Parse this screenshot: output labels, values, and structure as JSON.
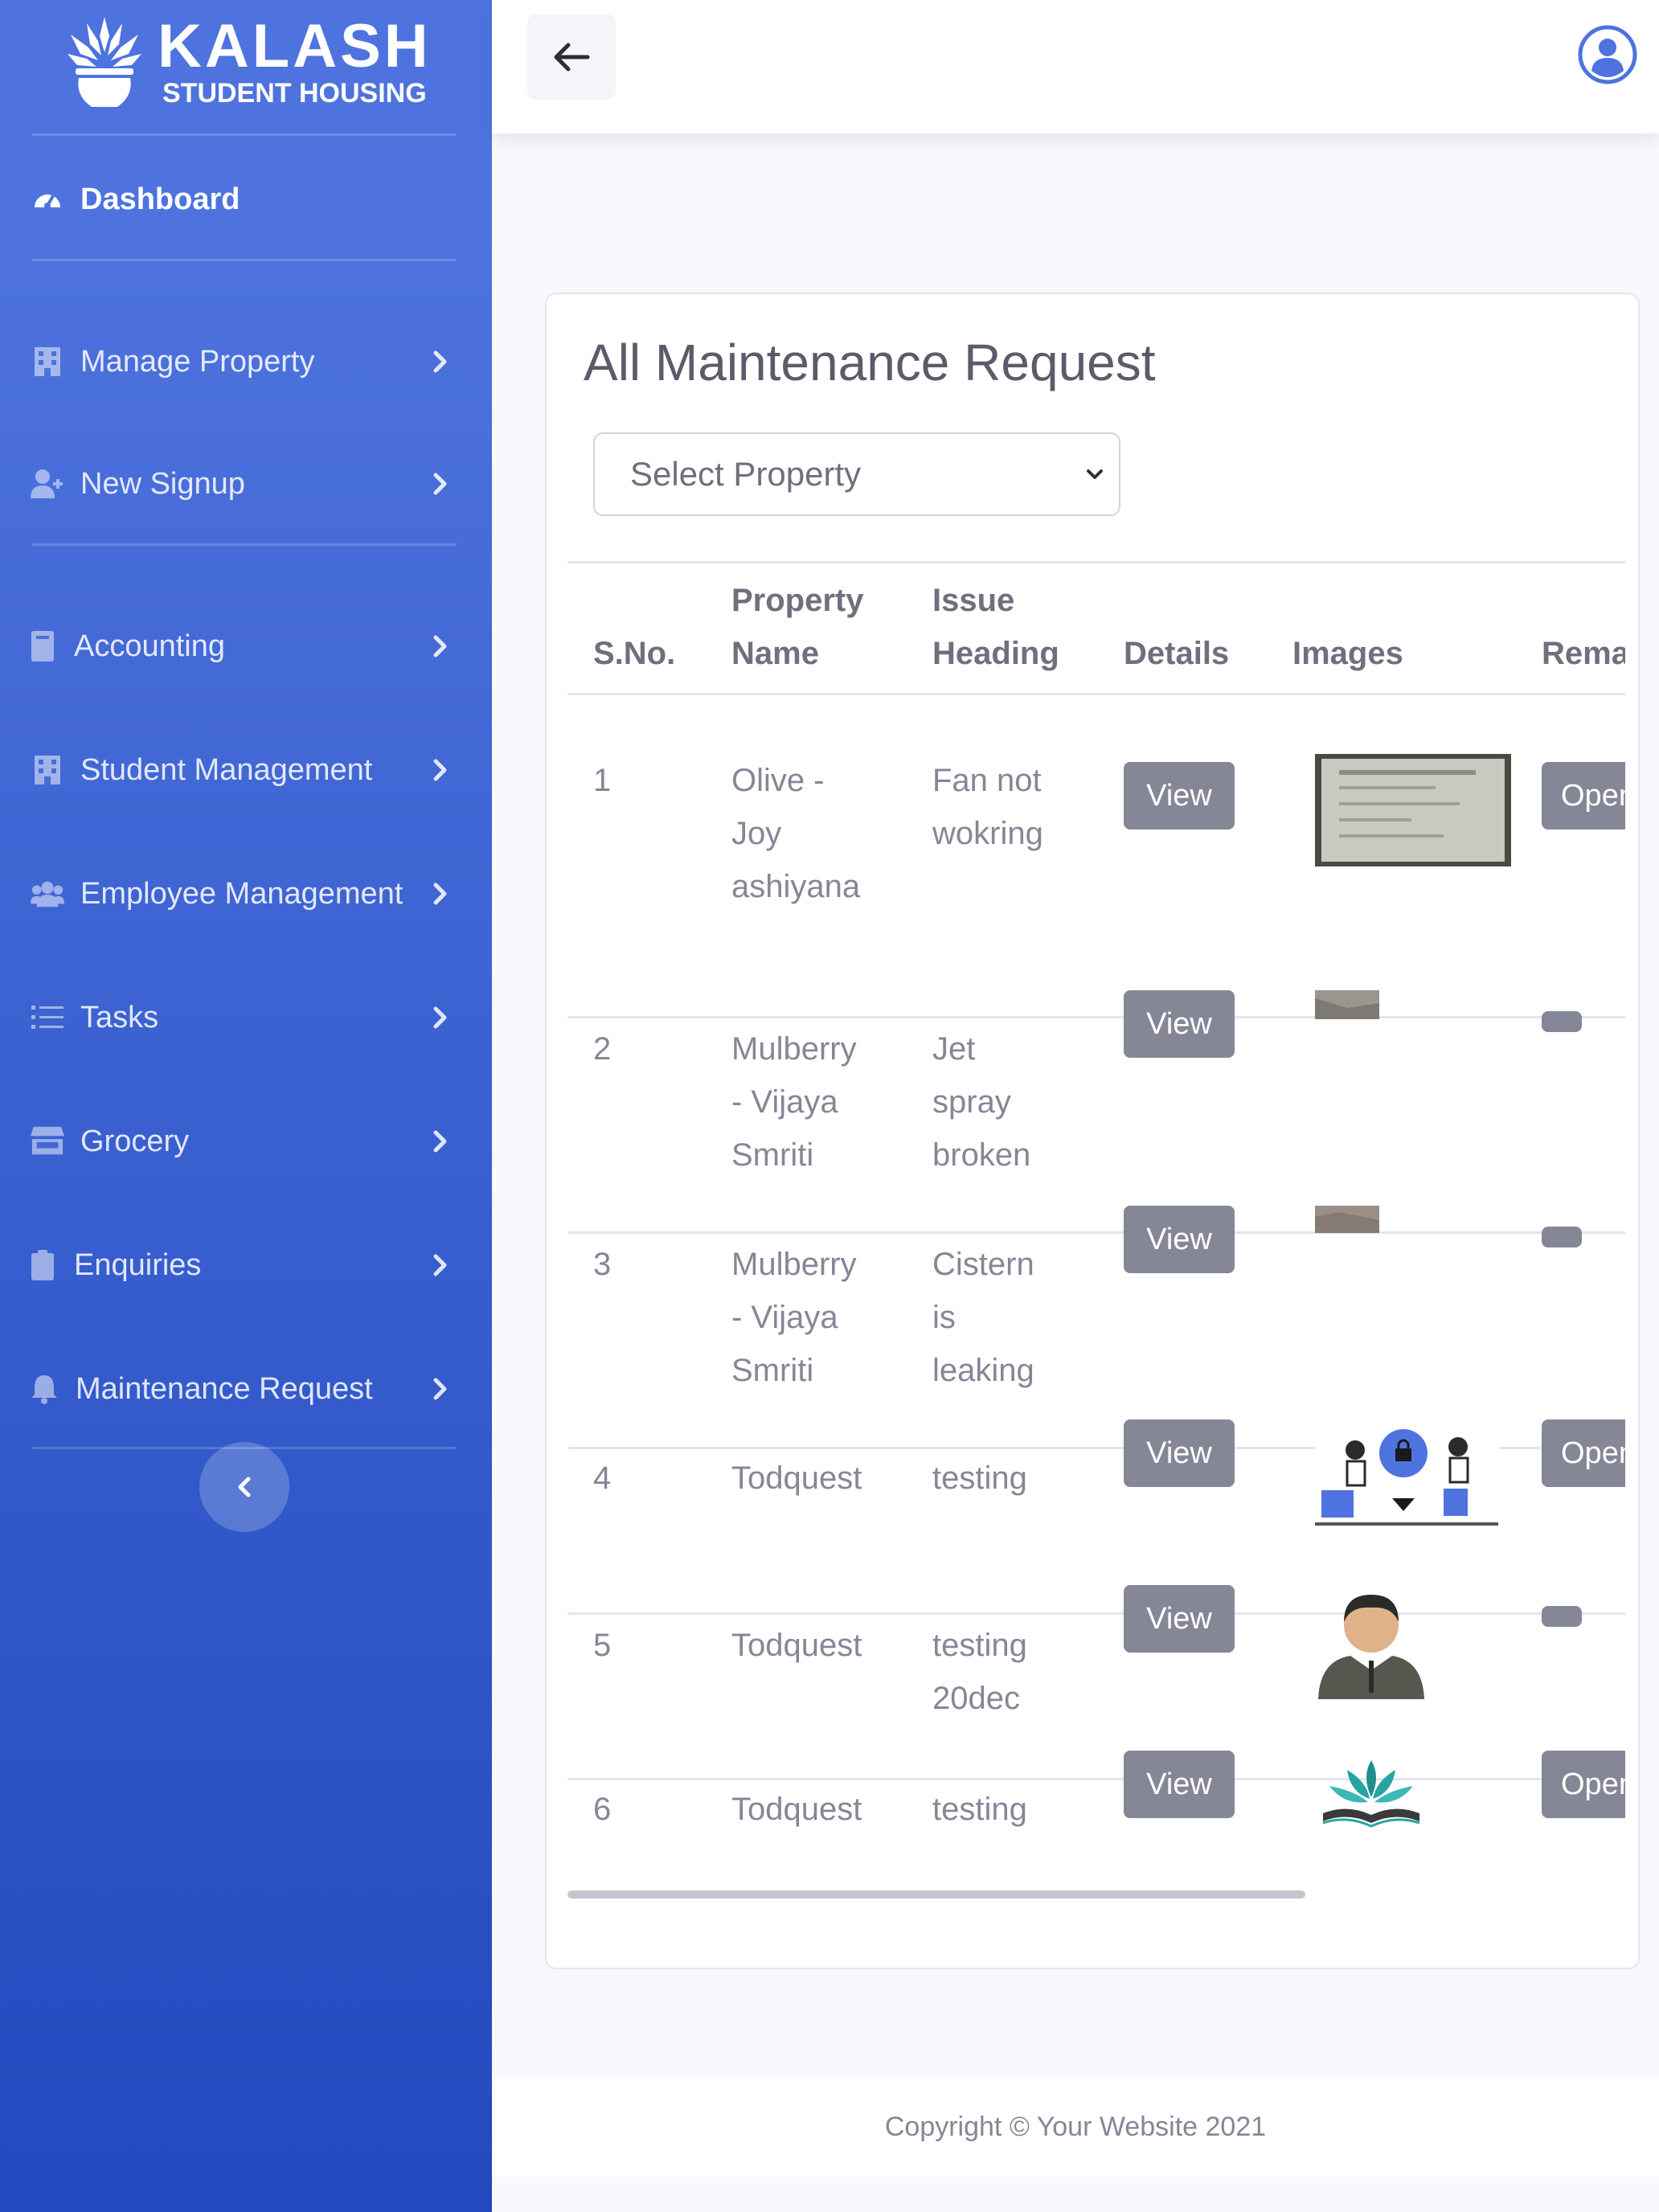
{
  "brand": {
    "title": "KALASH",
    "subtitle": "STUDENT HOUSING"
  },
  "sidebar": {
    "items": [
      {
        "label": "Dashboard",
        "icon": "tachometer-icon",
        "active": true
      },
      {
        "label": "Manage Property",
        "icon": "building-icon"
      },
      {
        "label": "New Signup",
        "icon": "user-plus-icon"
      },
      {
        "label": "Accounting",
        "icon": "book-icon"
      },
      {
        "label": "Student Management",
        "icon": "building-icon"
      },
      {
        "label": "Employee Management",
        "icon": "users-icon"
      },
      {
        "label": "Tasks",
        "icon": "list-icon"
      },
      {
        "label": "Grocery",
        "icon": "store-icon"
      },
      {
        "label": "Enquiries",
        "icon": "clipboard-icon"
      },
      {
        "label": "Maintenance Request",
        "icon": "bell-icon"
      }
    ]
  },
  "main": {
    "title": "All Maintenance Request",
    "select": {
      "value": "Select Property"
    },
    "table": {
      "headers": [
        {
          "line1": "",
          "line2": "S.No."
        },
        {
          "line1": "Property",
          "line2": "Name"
        },
        {
          "line1": "Issue",
          "line2": "Heading"
        },
        {
          "line1": "",
          "line2": "Details"
        },
        {
          "line1": "",
          "line2": "Images"
        },
        {
          "line1": "",
          "line2": "Remarks"
        }
      ],
      "view_label": "View",
      "open_label": "Open",
      "rows": [
        {
          "sno": "1",
          "property": [
            "Olive -",
            "Joy",
            "ashiyana"
          ],
          "issue": [
            "Fan not",
            "wokring"
          ],
          "image": "document-photo",
          "remark": "button"
        },
        {
          "sno": "2",
          "property": [
            "Mulberry",
            "- Vijaya",
            "Smriti"
          ],
          "issue": [
            "Jet",
            "spray",
            "broken"
          ],
          "image": "small-photo",
          "remark": "pill"
        },
        {
          "sno": "3",
          "property": [
            "Mulberry",
            "- Vijaya",
            "Smriti"
          ],
          "issue": [
            "Cistern",
            "is",
            "leaking"
          ],
          "image": "small-photo",
          "remark": "pill"
        },
        {
          "sno": "4",
          "property": [
            "Todquest"
          ],
          "issue": [
            "testing"
          ],
          "image": "people-illustration",
          "remark": "button"
        },
        {
          "sno": "5",
          "property": [
            "Todquest"
          ],
          "issue": [
            "testing",
            "20dec"
          ],
          "image": "businessman-avatar",
          "remark": "pill"
        },
        {
          "sno": "6",
          "property": [
            "Todquest"
          ],
          "issue": [
            "testing"
          ],
          "image": "lotus-book-logo",
          "remark": "button"
        }
      ]
    }
  },
  "footer": {
    "text": "Copyright © Your Website 2021"
  },
  "colors": {
    "sidebar_top": "#4e73df",
    "sidebar_bottom": "#224abe",
    "button_gray": "#858796",
    "primary": "#4e73df"
  }
}
